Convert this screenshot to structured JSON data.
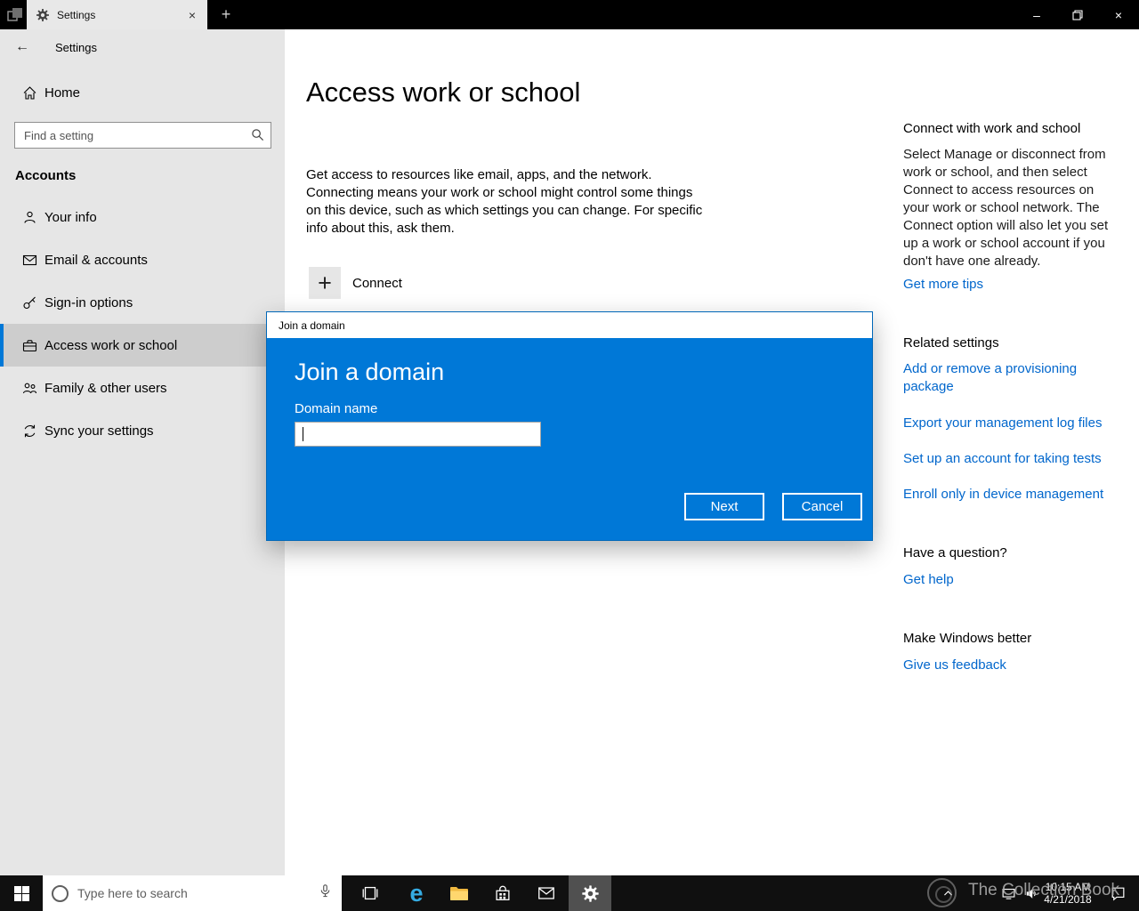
{
  "window": {
    "tab_title": "Settings"
  },
  "icons": {
    "back": "←",
    "tab_close": "×",
    "new_tab": "+",
    "minimize": "–",
    "close": "×",
    "connect_plus": "+"
  },
  "sidebar": {
    "back_title": "Settings",
    "home_label": "Home",
    "search_placeholder": "Find a setting",
    "section_title": "Accounts",
    "items": [
      {
        "label": "Your info",
        "icon": "person-icon",
        "selected": false
      },
      {
        "label": "Email & accounts",
        "icon": "envelope-icon",
        "selected": false
      },
      {
        "label": "Sign-in options",
        "icon": "key-icon",
        "selected": false
      },
      {
        "label": "Access work or school",
        "icon": "briefcase-icon",
        "selected": true
      },
      {
        "label": "Family & other users",
        "icon": "people-icon",
        "selected": false
      },
      {
        "label": "Sync your settings",
        "icon": "sync-icon",
        "selected": false
      }
    ]
  },
  "main": {
    "page_title": "Access work or school",
    "description": "Get access to resources like email, apps, and the network. Connecting means your work or school might control some things on this device, such as which settings you can change. For specific info about this, ask them.",
    "connect_label": "Connect"
  },
  "dialog": {
    "window_title": "Join a domain",
    "heading": "Join a domain",
    "field_label": "Domain name",
    "input_value": "",
    "buttons": {
      "next": "Next",
      "cancel": "Cancel"
    },
    "accent_color": "#0078d7"
  },
  "aside": {
    "help_title": "Connect with work and school",
    "help_body": "Select Manage or disconnect from work or school, and then select Connect to access resources on your work or school network. The Connect option will also let you set up a work or school account if you don't have one already.",
    "help_link": "Get more tips",
    "related_title": "Related settings",
    "related_links": [
      "Add or remove a provisioning package",
      "Export your management log files",
      "Set up an account for taking tests",
      "Enroll only in device management"
    ],
    "question_title": "Have a question?",
    "question_link": "Get help",
    "better_title": "Make Windows better",
    "better_link": "Give us feedback"
  },
  "taskbar": {
    "search_placeholder": "Type here to search",
    "tray": {
      "time": "10:15 AM",
      "date": "4/21/2018"
    }
  },
  "watermark": "The Collection Book"
}
